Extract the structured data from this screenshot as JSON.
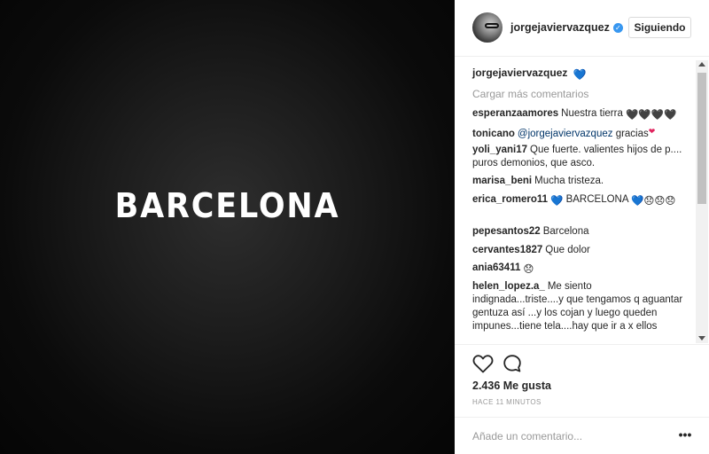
{
  "post": {
    "image_text": "BARCELONA"
  },
  "header": {
    "username": "jorgejaviervazquez",
    "follow_label": "Siguiendo"
  },
  "caption": {
    "username": "jorgejaviervazquez",
    "emoji": "💙"
  },
  "load_more_label": "Cargar más comentarios",
  "comments": [
    {
      "user": "esperanzaamores",
      "text": "Nuestra tierra",
      "emoji": "🖤🖤🖤🖤"
    },
    {
      "user": "tonicano",
      "mention": "@jorgejaviervazquez",
      "text": "gracias",
      "emoji": "❤"
    },
    {
      "user": "yoli_yani17",
      "text": "Que fuerte. valientes hijos de p.... puros demonios, que asco."
    },
    {
      "user": "marisa_beni",
      "text": "Mucha tristeza."
    },
    {
      "user": "erica_romero11",
      "pre_emoji": "💙",
      "text": "BARCELONA",
      "emoji": "💙😞😞😞"
    },
    {
      "user": "pepesantos22",
      "text": "Barcelona"
    },
    {
      "user": "cervantes1827",
      "text": "Que dolor"
    },
    {
      "user": "ania63411",
      "text": "",
      "emoji": "😞"
    },
    {
      "user": "helen_lopez.a_",
      "text": "Me siento indignada...triste....y que tengamos q aguantar gentuza así ...y los cojan y luego queden impunes...tiene tela....hay que ir a x ellos"
    }
  ],
  "likes_label": "2.436 Me gusta",
  "time_label": "HACE 11 MINUTOS",
  "add_comment": {
    "placeholder": "Añade un comentario..."
  },
  "more_label": "•••",
  "icons": [
    "heart-icon",
    "comment-icon",
    "verified-icon",
    "more-options-icon"
  ],
  "colors": {
    "verified": "#3897f0",
    "link": "#003569",
    "muted": "#999999"
  }
}
